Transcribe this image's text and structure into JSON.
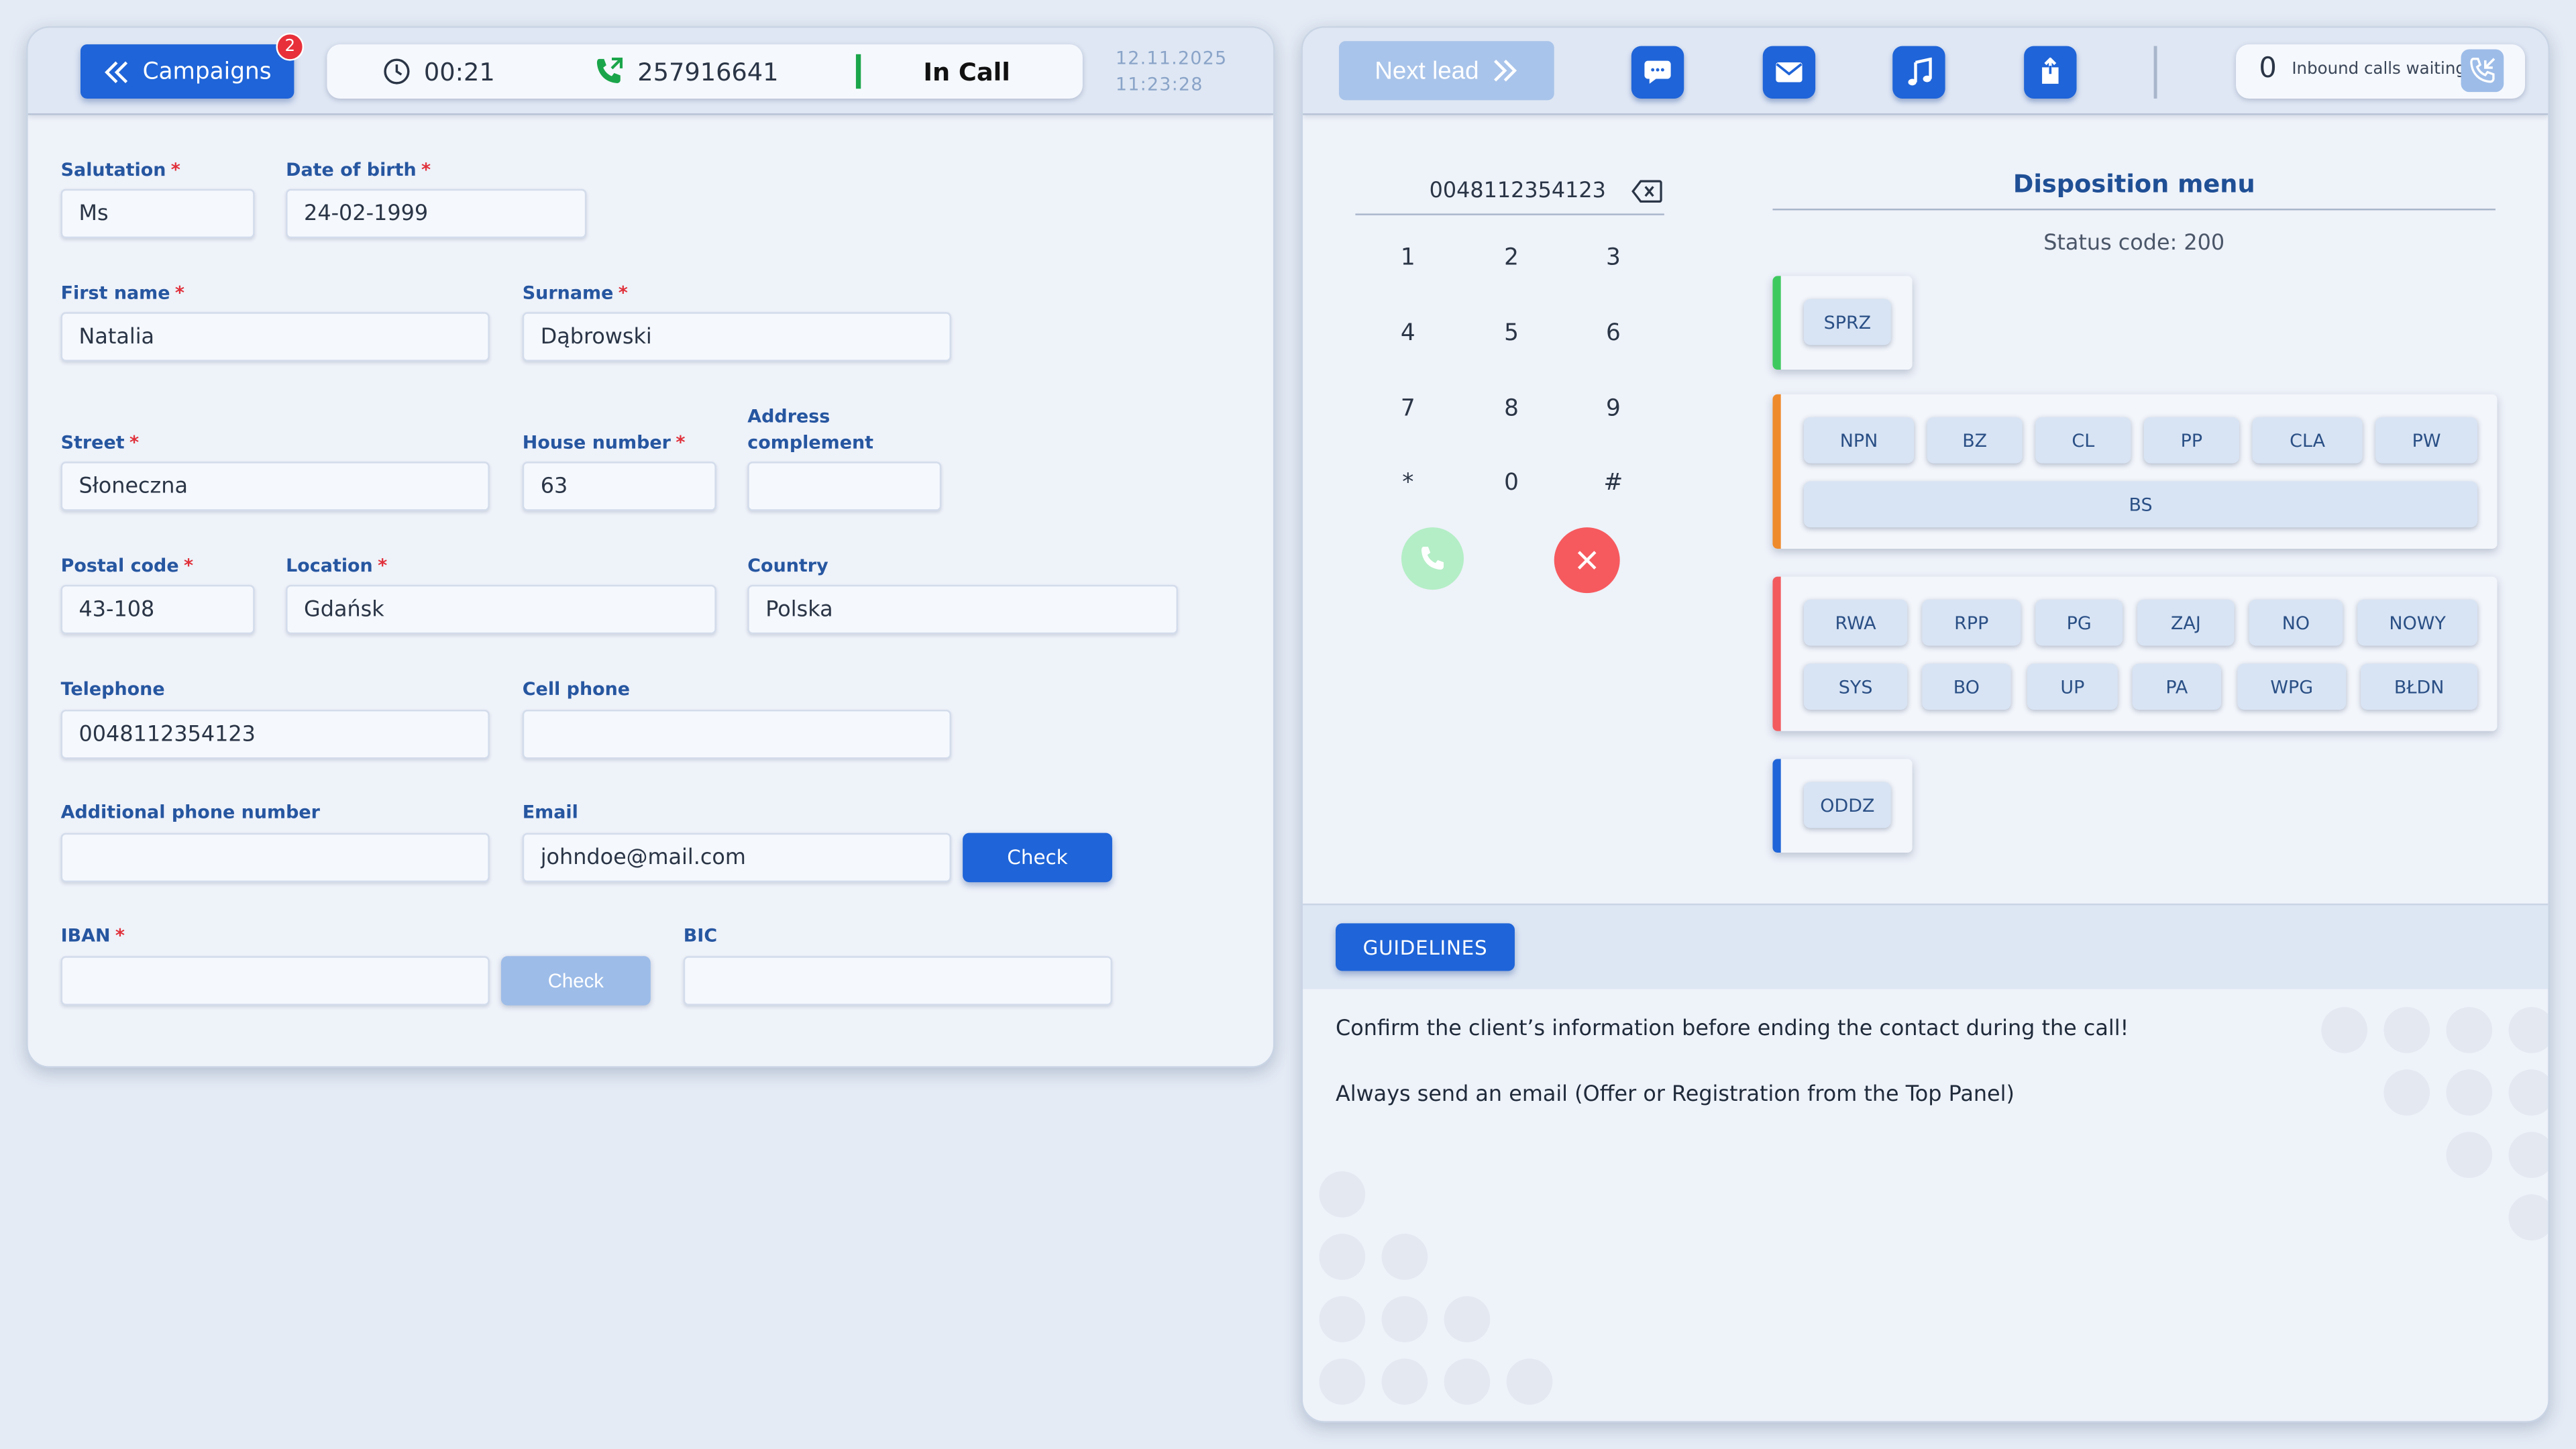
{
  "header": {
    "campaigns_label": "Campaigns",
    "campaigns_badge": "2",
    "timer": "00:21",
    "phone_number": "257916641",
    "call_status": "In Call",
    "date": "12.11.2025",
    "time": "11:23:28"
  },
  "form": {
    "salutation": {
      "label": "Salutation",
      "value": "Ms",
      "required": true
    },
    "dob": {
      "label": "Date of birth",
      "value": "24-02-1999",
      "required": true
    },
    "first_name": {
      "label": "First name",
      "value": "Natalia",
      "required": true
    },
    "surname": {
      "label": "Surname",
      "value": "Dąbrowski",
      "required": true
    },
    "street": {
      "label": "Street",
      "value": "Słoneczna",
      "required": true
    },
    "house_number": {
      "label": "House number",
      "value": "63",
      "required": true
    },
    "address_complement": {
      "label_line1": "Address",
      "label_line2": "complement",
      "value": ""
    },
    "postal_code": {
      "label": "Postal code",
      "value": "43-108",
      "required": true
    },
    "location": {
      "label": "Location",
      "value": "Gdańsk",
      "required": true
    },
    "country": {
      "label": "Country",
      "value": "Polska"
    },
    "telephone": {
      "label": "Telephone",
      "value": "0048112354123"
    },
    "cell_phone": {
      "label": "Cell phone",
      "value": ""
    },
    "additional_phone": {
      "label": "Additional phone number",
      "value": ""
    },
    "email": {
      "label": "Email",
      "value": "johndoe@mail.com",
      "check_label": "Check"
    },
    "iban": {
      "label": "IBAN",
      "value": "",
      "required": true,
      "check_label": "Check"
    },
    "bic": {
      "label": "BIC",
      "value": ""
    }
  },
  "toolbar": {
    "next_lead_label": "Next lead",
    "icons": [
      "chat-icon",
      "mail-icon",
      "music-icon",
      "transfer-icon"
    ],
    "inbound_count": "0",
    "inbound_label": "Inbound calls waiting"
  },
  "dialpad": {
    "display": "0048112354123",
    "keys": [
      "1",
      "2",
      "3",
      "4",
      "5",
      "6",
      "7",
      "8",
      "9",
      "*",
      "0",
      "#"
    ]
  },
  "disposition": {
    "title": "Disposition menu",
    "status_code": "Status code: 200",
    "groups": [
      {
        "color": "#3ec95f",
        "buttons": [
          "SPRZ"
        ]
      },
      {
        "color": "#ef8a2c",
        "buttons": [
          "NPN",
          "BZ",
          "CL",
          "PP",
          "CLA",
          "PW",
          "BS"
        ]
      },
      {
        "color": "#f25a5e",
        "buttons": [
          "RWA",
          "RPP",
          "PG",
          "ZAJ",
          "NO",
          "NOWY",
          "SYS",
          "BO",
          "UP",
          "PA",
          "WPG",
          "BŁDN"
        ]
      },
      {
        "color": "#1f64d8",
        "buttons": [
          "ODDZ"
        ]
      }
    ]
  },
  "guidelines": {
    "button_label": "GUIDELINES",
    "lines": [
      "Confirm the client’s information before ending the contact during the call!",
      "Always send an email (Offer or Registration from the Top Panel)"
    ]
  },
  "colors": {
    "primary": "#1f64d8",
    "required": "#e0303a",
    "in_call": "#1aa54a"
  }
}
